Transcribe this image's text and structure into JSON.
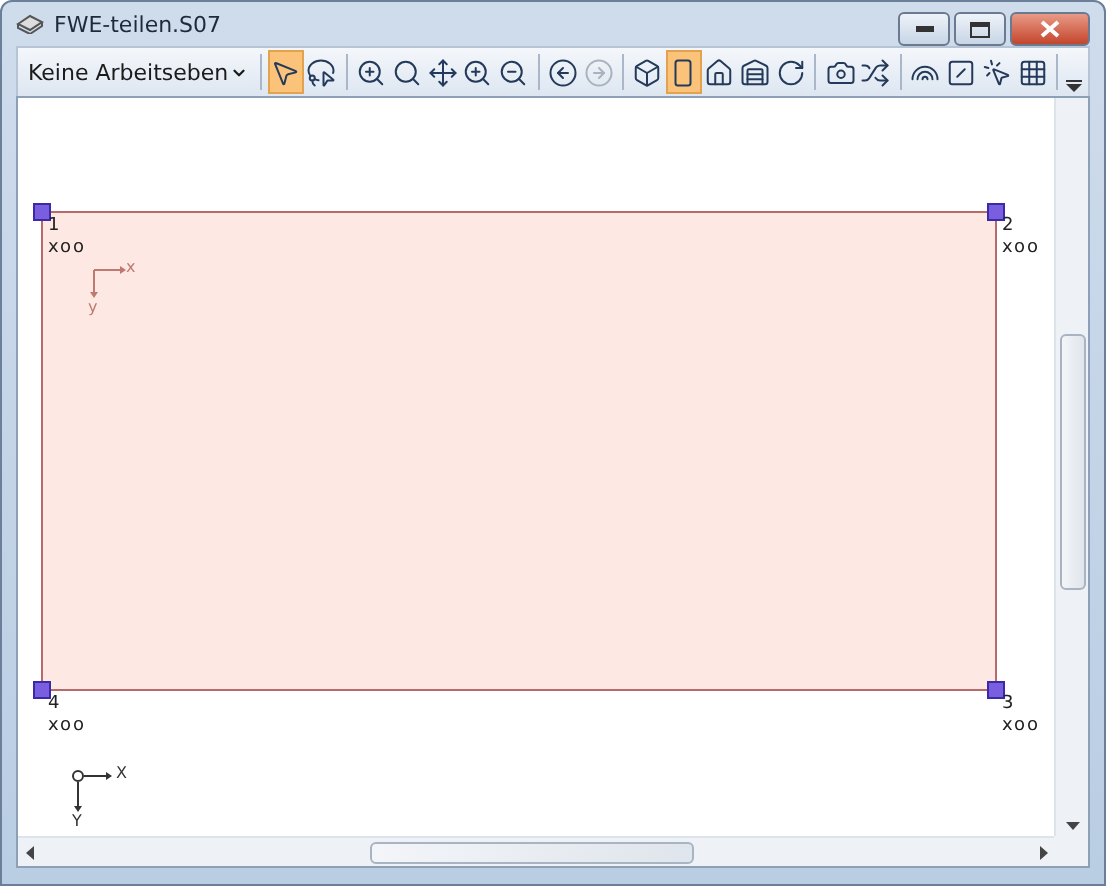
{
  "window": {
    "title": "FWE-teilen.S07"
  },
  "toolbar": {
    "dropdown": "Keine Arbeitseben",
    "tool_groups": [
      [
        {
          "kind": "pointer",
          "selected": true,
          "disabled": false
        },
        {
          "kind": "lasso",
          "selected": false,
          "disabled": false
        }
      ],
      [
        {
          "kind": "zoom-in",
          "selected": false,
          "disabled": false
        },
        {
          "kind": "search",
          "selected": false,
          "disabled": false
        },
        {
          "kind": "move",
          "selected": false,
          "disabled": false
        },
        {
          "kind": "zoom-plus",
          "selected": false,
          "disabled": false
        },
        {
          "kind": "zoom-out",
          "selected": false,
          "disabled": false
        }
      ],
      [
        {
          "kind": "back",
          "selected": false,
          "disabled": false
        },
        {
          "kind": "forward",
          "selected": false,
          "disabled": true
        }
      ],
      [
        {
          "kind": "box",
          "selected": false,
          "disabled": false
        },
        {
          "kind": "frame",
          "selected": true,
          "disabled": false
        },
        {
          "kind": "house",
          "selected": false,
          "disabled": false
        },
        {
          "kind": "warehouse",
          "selected": false,
          "disabled": false
        },
        {
          "kind": "rotate",
          "selected": false,
          "disabled": false
        }
      ],
      [
        {
          "kind": "camera",
          "selected": false,
          "disabled": false
        },
        {
          "kind": "shuffle",
          "selected": false,
          "disabled": false
        }
      ],
      [
        {
          "kind": "rainbow",
          "selected": false,
          "disabled": false
        },
        {
          "kind": "slash",
          "selected": false,
          "disabled": false
        },
        {
          "kind": "click",
          "selected": false,
          "disabled": false
        },
        {
          "kind": "grid",
          "selected": false,
          "disabled": false
        }
      ]
    ]
  },
  "canvas": {
    "nodes": [
      {
        "number": "1",
        "label": "xoo"
      },
      {
        "number": "2",
        "label": "xoo"
      },
      {
        "number": "4",
        "label": "xoo"
      },
      {
        "number": "3",
        "label": "xoo"
      }
    ],
    "local_axes": {
      "x": "x",
      "y": "y"
    },
    "global_axes": {
      "x": "X",
      "y": "Y"
    }
  }
}
